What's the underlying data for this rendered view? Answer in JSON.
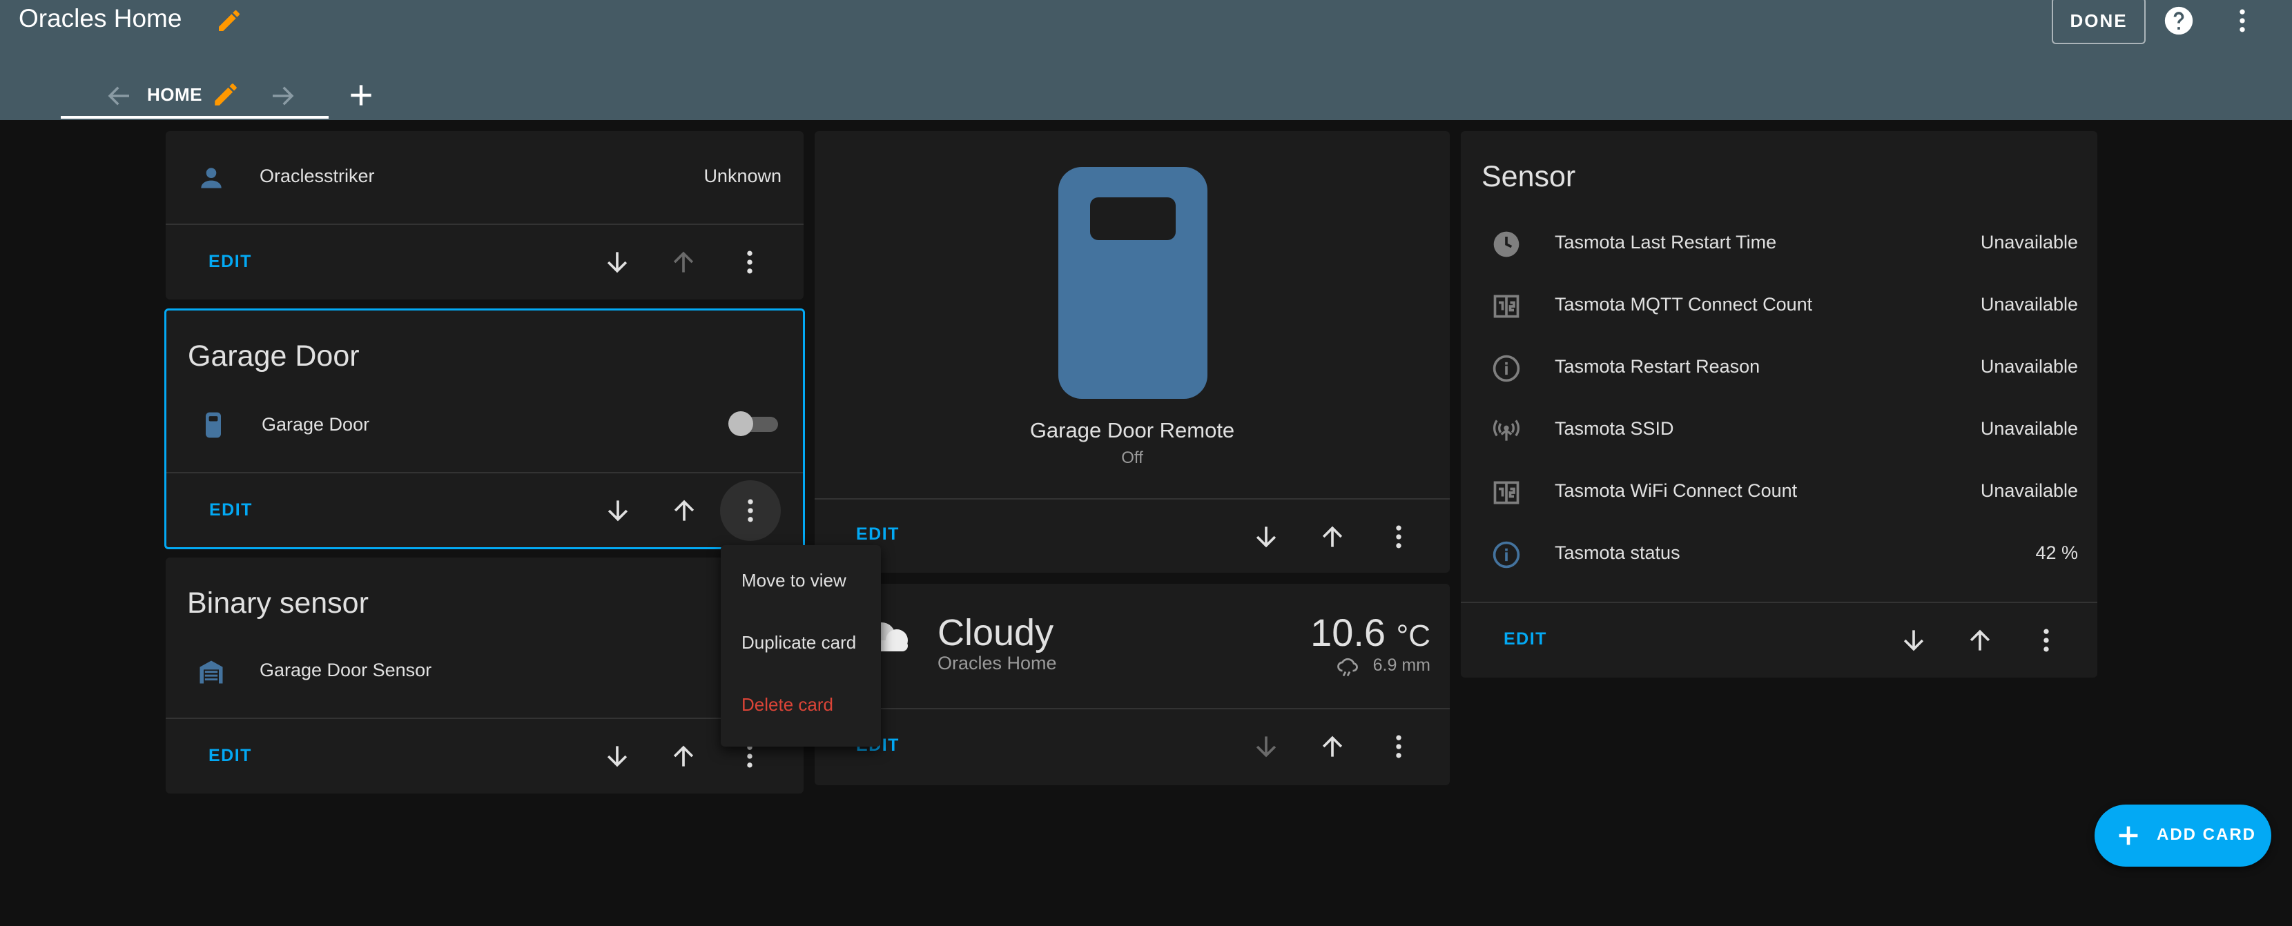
{
  "header": {
    "title": "Oracles Home",
    "done_label": "DONE",
    "tab": {
      "label": "HOME"
    }
  },
  "cards": {
    "person": {
      "row": {
        "icon": "account-icon",
        "name": "Oraclesstriker",
        "state": "Unknown"
      },
      "edit_label": "EDIT"
    },
    "garage_door": {
      "title": "Garage Door",
      "row": {
        "icon": "garage-remote-icon",
        "name": "Garage Door",
        "toggle_on": false
      },
      "edit_label": "EDIT"
    },
    "binary_sensor": {
      "title": "Binary sensor",
      "row": {
        "icon": "garage-icon",
        "name": "Garage Door Sensor"
      },
      "edit_label": "EDIT"
    },
    "garage_remote": {
      "name": "Garage Door Remote",
      "state": "Off",
      "edit_label": "EDIT"
    },
    "weather": {
      "condition": "Cloudy",
      "location": "Oracles Home",
      "temperature": "10.6",
      "unit": "°C",
      "precipitation": "6.9 mm",
      "edit_label": "EDIT"
    },
    "sensor": {
      "title": "Sensor",
      "rows": [
        {
          "icon": "clock-icon",
          "name": "Tasmota Last Restart Time",
          "state": "Unavailable"
        },
        {
          "icon": "counter-icon",
          "name": "Tasmota MQTT Connect Count",
          "state": "Unavailable"
        },
        {
          "icon": "info-icon",
          "name": "Tasmota Restart Reason",
          "state": "Unavailable"
        },
        {
          "icon": "wifi-antenna-icon",
          "name": "Tasmota SSID",
          "state": "Unavailable"
        },
        {
          "icon": "counter-icon",
          "name": "Tasmota WiFi Connect Count",
          "state": "Unavailable"
        },
        {
          "icon": "info-icon",
          "name": "Tasmota status",
          "state": "42 %"
        }
      ],
      "edit_label": "EDIT"
    }
  },
  "menu": {
    "items": [
      "Move to view",
      "Duplicate card",
      "Delete card"
    ]
  },
  "fab": {
    "label": "ADD CARD"
  },
  "colors": {
    "header_bg": "#455a64",
    "accent": "#03a9f4",
    "edit_pencil": "#ff9800",
    "entity_icon": "#44739e",
    "danger": "#db4437"
  }
}
